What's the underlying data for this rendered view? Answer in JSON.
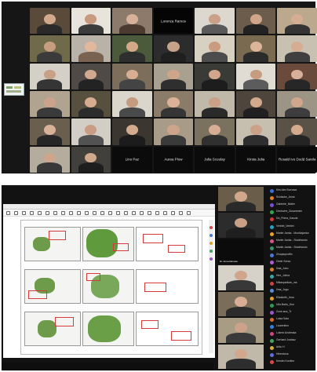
{
  "gallery": {
    "tiles": [
      {
        "name": "",
        "bg": "#5a4a3a",
        "skin": "#d2a98c",
        "cloth": "#2a2a2a"
      },
      {
        "name": "",
        "bg": "#e8e4dc",
        "skin": "#c79a7f",
        "cloth": "#3c3c3c"
      },
      {
        "name": "",
        "bg": "#8c7a6a",
        "skin": "#d8b19a",
        "cloth": "#4a3a2f"
      },
      {
        "name": "",
        "bg": "#050505",
        "skin": "",
        "cloth": "",
        "blank": true,
        "label": "Lorenza Ramos"
      },
      {
        "name": "",
        "bg": "#dcd8d0",
        "skin": "#caa088",
        "cloth": "#5a5a5a"
      },
      {
        "name": "",
        "bg": "#6c5c4c",
        "skin": "#d0a58a",
        "cloth": "#222222"
      },
      {
        "name": "",
        "bg": "#bca88c",
        "skin": "#d5ad92",
        "cloth": "#343434"
      },
      {
        "name": "",
        "bg": "#6f6a4a",
        "skin": "#c89c80",
        "cloth": "#3b3b3b"
      },
      {
        "name": "",
        "bg": "#b8b2a8",
        "skin": "#e2b89c",
        "cloth": "#7a6250"
      },
      {
        "name": "",
        "bg": "#4a5a3a",
        "skin": "#d4a98a",
        "cloth": "#2e2e2e"
      },
      {
        "name": "",
        "bg": "#2c2c2c",
        "skin": "#c7a28a",
        "cloth": "#1f1f1f"
      },
      {
        "name": "",
        "bg": "#d8d0c0",
        "skin": "#c99c82",
        "cloth": "#4c4c4c"
      },
      {
        "name": "",
        "bg": "#7a6a50",
        "skin": "#dcb49a",
        "cloth": "#2b2b2b"
      },
      {
        "name": "",
        "bg": "#c8c0b0",
        "skin": "#d6ad92",
        "cloth": "#3f3f3f"
      },
      {
        "name": "",
        "bg": "#d4d0c8",
        "skin": "#c8a086",
        "cloth": "#353535"
      },
      {
        "name": "",
        "bg": "#4f4a46",
        "skin": "#d2a890",
        "cloth": "#232323"
      },
      {
        "name": "",
        "bg": "#7c6e5a",
        "skin": "#d7ae93",
        "cloth": "#444444"
      },
      {
        "name": "",
        "bg": "#a8a090",
        "skin": "#cfa589",
        "cloth": "#2f2f2f"
      },
      {
        "name": "",
        "bg": "#3a3a36",
        "skin": "#d1a68b",
        "cloth": "#1d1d1d"
      },
      {
        "name": "",
        "bg": "#e0dcd4",
        "skin": "#c79c81",
        "cloth": "#5c5c5c"
      },
      {
        "name": "",
        "bg": "#6a4a3a",
        "skin": "#d8b09a",
        "cloth": "#272727"
      },
      {
        "name": "",
        "bg": "#b0a490",
        "skin": "#cda28a",
        "cloth": "#3a3a3a"
      },
      {
        "name": "",
        "bg": "#58503e",
        "skin": "#d6ac90",
        "cloth": "#2c2c2c"
      },
      {
        "name": "",
        "bg": "#dad6cc",
        "skin": "#c59b80",
        "cloth": "#4a4a4a"
      },
      {
        "name": "",
        "bg": "#8a7c68",
        "skin": "#dbb297",
        "cloth": "#353535"
      },
      {
        "name": "",
        "bg": "#c0b8a8",
        "skin": "#caa087",
        "cloth": "#2a2a2a"
      },
      {
        "name": "",
        "bg": "#4e463c",
        "skin": "#d3a98e",
        "cloth": "#202020"
      },
      {
        "name": "",
        "bg": "#9c9484",
        "skin": "#d0a78c",
        "cloth": "#3d3d3d"
      },
      {
        "name": "",
        "bg": "#6a5e4e",
        "skin": "#d9b098",
        "cloth": "#262626"
      },
      {
        "name": "",
        "bg": "#d2cec6",
        "skin": "#c89d83",
        "cloth": "#525252"
      },
      {
        "name": "",
        "bg": "#3c3630",
        "skin": "#d5ab90",
        "cloth": "#1c1c1c"
      },
      {
        "name": "",
        "bg": "#a89c88",
        "skin": "#cea58a",
        "cloth": "#3a3a3a"
      },
      {
        "name": "",
        "bg": "#7a725e",
        "skin": "#d7ae94",
        "cloth": "#303030"
      },
      {
        "name": "",
        "bg": "#c6beae",
        "skin": "#cba188",
        "cloth": "#2e2e2e"
      },
      {
        "name": "",
        "bg": "#5a5246",
        "skin": "#d4aa8f",
        "cloth": "#242424"
      },
      {
        "name": "",
        "bg": "#b4ac9c",
        "skin": "#cfa68b",
        "cloth": "#383838"
      },
      {
        "name": "",
        "bg": "#42403a",
        "skin": "#d2a88d",
        "cloth": "#1e1e1e"
      },
      {
        "name": "Lino Paz",
        "bg": "#0b0b0b",
        "skin": "",
        "cloth": "",
        "blank": true,
        "label": "Lino Paz"
      },
      {
        "name": "Aurea Plow",
        "bg": "#0b0b0b",
        "skin": "",
        "cloth": "",
        "blank": true,
        "label": "Aurea Plow"
      },
      {
        "name": "Julia Scoulay",
        "bg": "#0b0b0b",
        "skin": "",
        "cloth": "",
        "blank": true,
        "label": "Julia Scoulay"
      },
      {
        "name": "Kirsta Julia",
        "bg": "#0b0b0b",
        "skin": "",
        "cloth": "",
        "blank": true,
        "label": "Kirsta Julia"
      },
      {
        "name": "Rosald Ivo Dodd Sarela",
        "bg": "#0b0b0b",
        "skin": "",
        "cloth": "",
        "blank": true,
        "label": "Rosald Ivo Dodd Sarela"
      },
      {
        "name": "Maun Nikolas Sarela",
        "bg": "#0b0b0b",
        "skin": "",
        "cloth": "",
        "blank": true,
        "label": "Maun Nikolas Sarela"
      },
      {
        "name": "Elisabeth Scaella",
        "bg": "#0b0b0b",
        "skin": "",
        "cloth": "",
        "blank": true,
        "label": "Elisabeth Scaella"
      }
    ]
  },
  "share": {
    "side_videos": [
      {
        "name": "",
        "bg": "#6a5e4a",
        "skin": "#d2a88d",
        "cloth": "#2a2a2a"
      },
      {
        "name": "",
        "bg": "#2c2c2c",
        "skin": "#c9a086",
        "cloth": "#1f1f1f"
      },
      {
        "name": "",
        "bg": "#0b0b0b",
        "skin": "",
        "cloth": "",
        "label": "Dr. Anna Ranusa"
      },
      {
        "name": "",
        "bg": "#d6d2ca",
        "skin": "#cfa68b",
        "cloth": "#383838"
      },
      {
        "name": "",
        "bg": "#7a6e5a",
        "skin": "#d8ae94",
        "cloth": "#2c2c2c"
      },
      {
        "name": "",
        "bg": "#a89c84",
        "skin": "#cca28a",
        "cloth": "#3a3a3a"
      },
      {
        "name": "",
        "bg": "#c0b8a8",
        "skin": "#d1a88d",
        "cloth": "#2e2e2e"
      }
    ],
    "participants": [
      {
        "label": "Kim Alm Surruwa",
        "color": "#3d6fd6"
      },
      {
        "label": "Schlacke_Anna",
        "color": "#e0812a"
      },
      {
        "label": "Gabriele_Muller",
        "color": "#7a4fd0"
      },
      {
        "label": "Deutsche_Zusammen",
        "color": "#35a34a"
      },
      {
        "label": "Da_Prima_Kasula",
        "color": "#cf3b3b"
      },
      {
        "label": "Verblei_Verblei",
        "color": "#2a9fbf"
      },
      {
        "label": "Martin Janka - Monikajanka",
        "color": "#e3a427"
      },
      {
        "label": "Martin Janka - Studelando",
        "color": "#d2578d"
      },
      {
        "label": "Martin Janka - Studelando",
        "color": "#3f8f6a"
      },
      {
        "label": "Zinoptoprofflo",
        "color": "#4e74d4"
      },
      {
        "label": "Gede Sorsa",
        "color": "#ad5fd2"
      },
      {
        "label": "Ilma_Juko",
        "color": "#d47f2e"
      },
      {
        "label": "Hire_Jolina",
        "color": "#3aa5a0"
      },
      {
        "label": "Mikasparikan_ma",
        "color": "#c94444"
      },
      {
        "label": "Ilma_Jugo",
        "color": "#5c8dd8"
      },
      {
        "label": "Elisabeth_Irma",
        "color": "#e0a02d"
      },
      {
        "label": "Ulla Barto_Gun",
        "color": "#2f9a55"
      },
      {
        "label": "Zone ana_Tr",
        "color": "#9b57c9"
      },
      {
        "label": "Luisa Sala",
        "color": "#d86c2c"
      },
      {
        "label": "Laurentino",
        "color": "#3a7ed3"
      },
      {
        "label": "Lukrez Andreaka",
        "color": "#c84a7e"
      },
      {
        "label": "Gerhard Justasz",
        "color": "#46a35e"
      },
      {
        "label": "Arttu H",
        "color": "#d6b03a"
      },
      {
        "label": "Hiirentona",
        "color": "#5e6fd6"
      },
      {
        "label": "Kerstin Kordine",
        "color": "#d64b4b"
      }
    ]
  }
}
